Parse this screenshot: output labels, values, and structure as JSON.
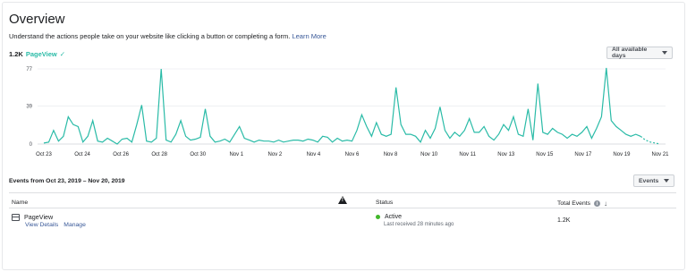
{
  "header": {
    "title": "Overview",
    "subtitle": "Understand the actions people take on your website like clicking a button or completing a form.",
    "learn_more": "Learn More"
  },
  "metric": {
    "value": "1.2K",
    "name": "PageView",
    "check": "✓"
  },
  "date_filter": {
    "label": "All available days"
  },
  "chart_data": {
    "type": "line",
    "color": "#2abba7",
    "yticks": [
      "77",
      "39",
      "0"
    ],
    "ylim": [
      0,
      77
    ],
    "xticks": [
      "Oct 23",
      "Oct 24",
      "Oct 26",
      "Oct 28",
      "Oct 30",
      "Nov 1",
      "Nov 2",
      "Nov 4",
      "Nov 6",
      "Nov 8",
      "Nov 10",
      "Nov 11",
      "Nov 13",
      "Nov 15",
      "Nov 17",
      "Nov 19",
      "Nov 21"
    ],
    "values": [
      1,
      2,
      14,
      3,
      8,
      28,
      20,
      18,
      2,
      8,
      24,
      3,
      2,
      6,
      3,
      0,
      5,
      6,
      2,
      20,
      40,
      3,
      2,
      6,
      77,
      4,
      2,
      10,
      24,
      8,
      4,
      5,
      7,
      36,
      8,
      2,
      3,
      5,
      2,
      10,
      18,
      6,
      4,
      2,
      4,
      3,
      3,
      2,
      4,
      2,
      3,
      4,
      4,
      3,
      5,
      4,
      2,
      8,
      7,
      2,
      6,
      3,
      4,
      3,
      14,
      30,
      18,
      8,
      22,
      10,
      8,
      10,
      58,
      20,
      10,
      10,
      8,
      2,
      14,
      6,
      16,
      38,
      14,
      6,
      12,
      8,
      14,
      26,
      12,
      12,
      18,
      8,
      4,
      10,
      20,
      14,
      28,
      10,
      8,
      36,
      4,
      62,
      12,
      10,
      16,
      12,
      10,
      6,
      10,
      8,
      12,
      18,
      6,
      16,
      28,
      78,
      24,
      18,
      14,
      10,
      8,
      10,
      8,
      4,
      2,
      1,
      0
    ]
  },
  "events_section": {
    "range": "Events from Oct 23, 2019 – Nov 20, 2019",
    "filter_label": "Events",
    "columns": {
      "name": "Name",
      "status": "Status",
      "total": "Total Events"
    },
    "rows": [
      {
        "name": "PageView",
        "view_details": "View Details",
        "manage": "Manage",
        "status": "Active",
        "last_received": "Last received 28 minutes ago",
        "total": "1.2K"
      }
    ]
  }
}
